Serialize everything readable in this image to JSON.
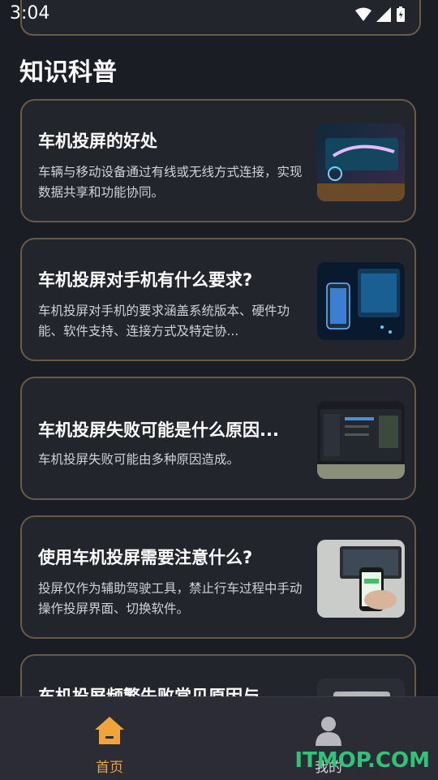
{
  "status": {
    "time": "3:04"
  },
  "section": {
    "title": "知识科普"
  },
  "cards": [
    {
      "title": "车机投屏的好处",
      "desc": "车辆与移动设备通过有线或无线方式连接，实现数据共享和功能协同。"
    },
    {
      "title": "车机投屏对手机有什么要求?",
      "desc": "车机投屏对手机的要求涵盖系统版本、硬件功能、软件支持、连接方式及特定协..."
    },
    {
      "title": "车机投屏失败可能是什么原因...",
      "desc": "车机投屏失败可能由多种原因造成。"
    },
    {
      "title": "使用车机投屏需要注意什么?",
      "desc": "投屏仅作为辅助驾驶工具，禁止行车过程中手动操作投屏界面、切换软件。"
    },
    {
      "title": "车机投屏频繁失败常见原因与...",
      "desc": ""
    }
  ],
  "nav": {
    "home": "首页",
    "mine": "我的"
  },
  "watermark": "ITMOP.COM",
  "colors": {
    "accent": "#f2a33a",
    "border": "#6a5a45",
    "card": "#23252d",
    "background": "#1b1d24"
  }
}
